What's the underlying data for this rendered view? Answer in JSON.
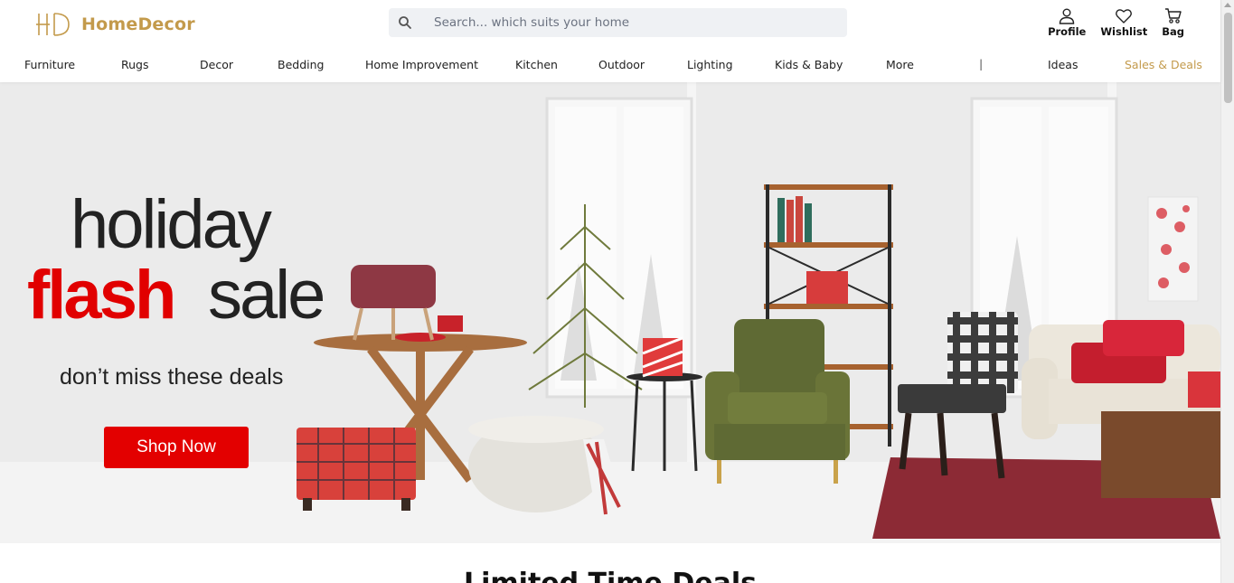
{
  "brand": {
    "name": "HomeDecor",
    "accent": "#c39a4b",
    "logo_icon": "hd-monogram-icon"
  },
  "search": {
    "placeholder": "Search... which suits your home"
  },
  "actions": [
    {
      "label": "Profile",
      "icon": "user-icon"
    },
    {
      "label": "Wishlist",
      "icon": "heart-icon"
    },
    {
      "label": "Bag",
      "icon": "cart-icon"
    }
  ],
  "nav": {
    "items": [
      "Furniture",
      "Rugs",
      "Decor",
      "Bedding",
      "Home Improvement",
      "Kitchen",
      "Outdoor",
      "Lighting",
      "Kids & Baby",
      "More"
    ],
    "separator": "|",
    "ideas": "Ideas",
    "deals": "Sales & Deals"
  },
  "hero": {
    "line1": "holiday",
    "line2_highlight": "flash",
    "line2_rest": "sale",
    "subline": "don’t miss these deals",
    "cta_label": "Shop Now",
    "cta_color": "#e30000",
    "highlight_color": "#e10000"
  },
  "section": {
    "title": "Limited Time Deals"
  }
}
